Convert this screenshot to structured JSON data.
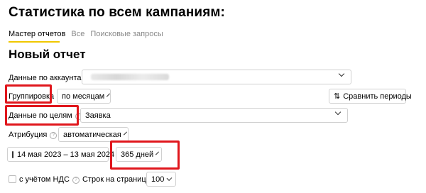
{
  "page": {
    "title": "Статистика по всем кампаниям:",
    "subtitle": "Новый отчет"
  },
  "tabs": [
    {
      "label": "Мастер отчетов",
      "active": true
    },
    {
      "label": "Все",
      "active": false
    },
    {
      "label": "Поисковые запросы",
      "active": false
    }
  ],
  "form": {
    "accounts_label": "Данные по аккаунтам",
    "grouping_label": "Группировка",
    "grouping_value": "по месяцам",
    "compare_label": "Сравнить периоды",
    "goals_label": "Данные по целям",
    "goals_value": "Заявка",
    "attribution_label": "Атрибуция",
    "attribution_value": "автоматическая",
    "date_range": "14 мая 2023 – 13 мая 2024",
    "period_value": "365 дней",
    "vat_label": "с учётом НДС",
    "rows_label": "Строк на странице",
    "rows_value": "100",
    "help_glyph": "?"
  },
  "colors": {
    "highlight": "#e0161c",
    "tab_underline": "#f0c800",
    "border": "#d0d0d0"
  },
  "icons": {
    "calendar": "calendar-icon",
    "compare": "compare-periods-icon",
    "help": "help-icon",
    "dropdown": "chevron-down-icon"
  }
}
